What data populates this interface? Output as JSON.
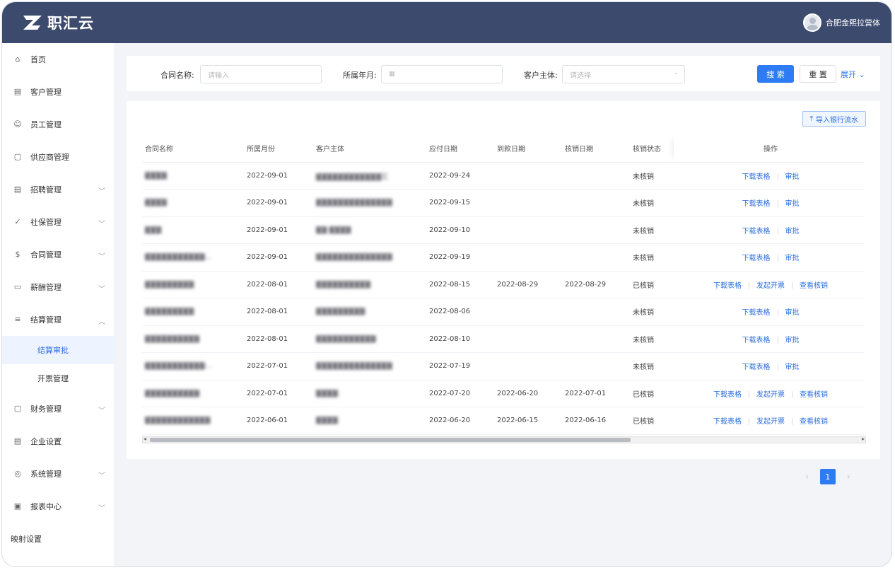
{
  "app": {
    "logo_text": "职汇云",
    "user_name": "合肥金熙拉营体"
  },
  "sidebar": {
    "items": [
      {
        "label": "首页",
        "icon": "home-icon",
        "glyph": "⌂",
        "chevron": false
      },
      {
        "label": "客户管理",
        "icon": "customer-icon",
        "glyph": "▤",
        "chevron": false
      },
      {
        "label": "员工管理",
        "icon": "user-icon",
        "glyph": "☺",
        "chevron": false
      },
      {
        "label": "供应商管理",
        "icon": "supplier-icon",
        "glyph": "▢",
        "chevron": false
      },
      {
        "label": "招聘管理",
        "icon": "recruit-icon",
        "glyph": "▤",
        "chevron": true
      },
      {
        "label": "社保管理",
        "icon": "social-security-icon",
        "glyph": "✓",
        "chevron": true
      },
      {
        "label": "合同管理",
        "icon": "contract-icon",
        "glyph": "$",
        "chevron": true
      },
      {
        "label": "薪酬管理",
        "icon": "salary-icon",
        "glyph": "▭",
        "chevron": true
      },
      {
        "label": "结算管理",
        "icon": "settlement-icon",
        "glyph": "≡",
        "chevron": true,
        "expanded": true
      }
    ],
    "sub_items": [
      {
        "label": "结算审批",
        "active": true
      },
      {
        "label": "开票管理",
        "active": false
      }
    ],
    "items_after": [
      {
        "label": "财务管理",
        "icon": "finance-icon",
        "glyph": "▢",
        "chevron": true
      },
      {
        "label": "企业设置",
        "icon": "company-settings-icon",
        "glyph": "▤",
        "chevron": false
      },
      {
        "label": "系统管理",
        "icon": "system-icon",
        "glyph": "◎",
        "chevron": true
      },
      {
        "label": "报表中心",
        "icon": "report-icon",
        "glyph": "▣",
        "chevron": true
      }
    ],
    "last_item": "映射设置"
  },
  "filter": {
    "contract_label": "合同名称:",
    "contract_placeholder": "请输入",
    "month_label": "所属年月:",
    "customer_label": "客户主体:",
    "customer_placeholder": "请选择",
    "search_button": "搜 索",
    "reset_button": "重 置",
    "expand_button": "展开"
  },
  "table": {
    "import_button": "导入银行流水",
    "headers": [
      "合同名称",
      "所属月份",
      "客户主体",
      "应付日期",
      "到款日期",
      "核销日期",
      "核销状态",
      "操作"
    ],
    "rows": [
      {
        "name": "▇▇▇▇",
        "month": "2022-09-01",
        "customer": "▇▇▇▇▇▇▇▇▇▇▇▇区",
        "due": "2022-09-24",
        "received": "",
        "writeoff": "",
        "status": "未核销",
        "actions": [
          "下载表格",
          "审批"
        ]
      },
      {
        "name": "▇▇▇▇",
        "month": "2022-09-01",
        "customer": "▇▇▇▇▇▇▇▇▇▇▇▇▇▇",
        "due": "2022-09-15",
        "received": "",
        "writeoff": "",
        "status": "未核销",
        "actions": [
          "下载表格",
          "审批"
        ]
      },
      {
        "name": "▇▇▇",
        "month": "2022-09-01",
        "customer": "▇▇ ▇▇▇▇",
        "due": "2022-09-10",
        "received": "",
        "writeoff": "",
        "status": "未核销",
        "actions": [
          "下载表格",
          "审批"
        ]
      },
      {
        "name": "▇▇▇▇▇▇▇▇▇▇▇...",
        "month": "2022-09-01",
        "customer": "▇▇▇▇▇▇▇▇▇▇▇▇▇▇",
        "due": "2022-09-19",
        "received": "",
        "writeoff": "",
        "status": "未核销",
        "actions": [
          "下载表格",
          "审批"
        ]
      },
      {
        "name": "▇▇▇▇▇▇▇▇▇",
        "month": "2022-08-01",
        "customer": "▇▇▇▇▇▇▇▇▇▇",
        "due": "2022-08-15",
        "received": "2022-08-29",
        "writeoff": "2022-08-29",
        "status": "已核销",
        "actions": [
          "下载表格",
          "发起开票",
          "查看核销"
        ]
      },
      {
        "name": "▇▇▇▇▇▇▇▇▇",
        "month": "2022-08-01",
        "customer": "▇▇▇▇▇▇▇▇▇",
        "due": "2022-08-06",
        "received": "",
        "writeoff": "",
        "status": "未核销",
        "actions": [
          "下载表格",
          "审批"
        ]
      },
      {
        "name": "▇▇▇▇▇▇▇▇▇▇",
        "month": "2022-08-01",
        "customer": "▇▇▇▇▇▇▇▇▇▇▇",
        "due": "2022-08-10",
        "received": "",
        "writeoff": "",
        "status": "未核销",
        "actions": [
          "下载表格",
          "审批"
        ]
      },
      {
        "name": "▇▇▇▇▇▇▇▇▇▇▇...",
        "month": "2022-07-01",
        "customer": "▇▇▇▇▇▇▇▇▇▇▇▇▇▇",
        "due": "2022-07-19",
        "received": "",
        "writeoff": "",
        "status": "未核销",
        "actions": [
          "下载表格",
          "审批"
        ]
      },
      {
        "name": "▇▇▇▇▇▇▇▇▇▇",
        "month": "2022-07-01",
        "customer": "▇▇▇▇",
        "due": "2022-07-20",
        "received": "2022-06-20",
        "writeoff": "2022-07-01",
        "status": "已核销",
        "actions": [
          "下载表格",
          "发起开票",
          "查看核销"
        ]
      },
      {
        "name": "▇▇▇▇▇▇▇▇▇▇▇▇",
        "month": "2022-06-01",
        "customer": "▇▇▇▇",
        "due": "2022-06-20",
        "received": "2022-06-15",
        "writeoff": "2022-06-16",
        "status": "已核销",
        "actions": [
          "下载表格",
          "发起开票",
          "查看核销"
        ]
      }
    ]
  },
  "pagination": {
    "current": "1",
    "prev": "‹",
    "next": "›"
  },
  "colors": {
    "header_bg": "#3c4a6e",
    "primary": "#2d7cf3",
    "link": "#2d6fe0"
  }
}
